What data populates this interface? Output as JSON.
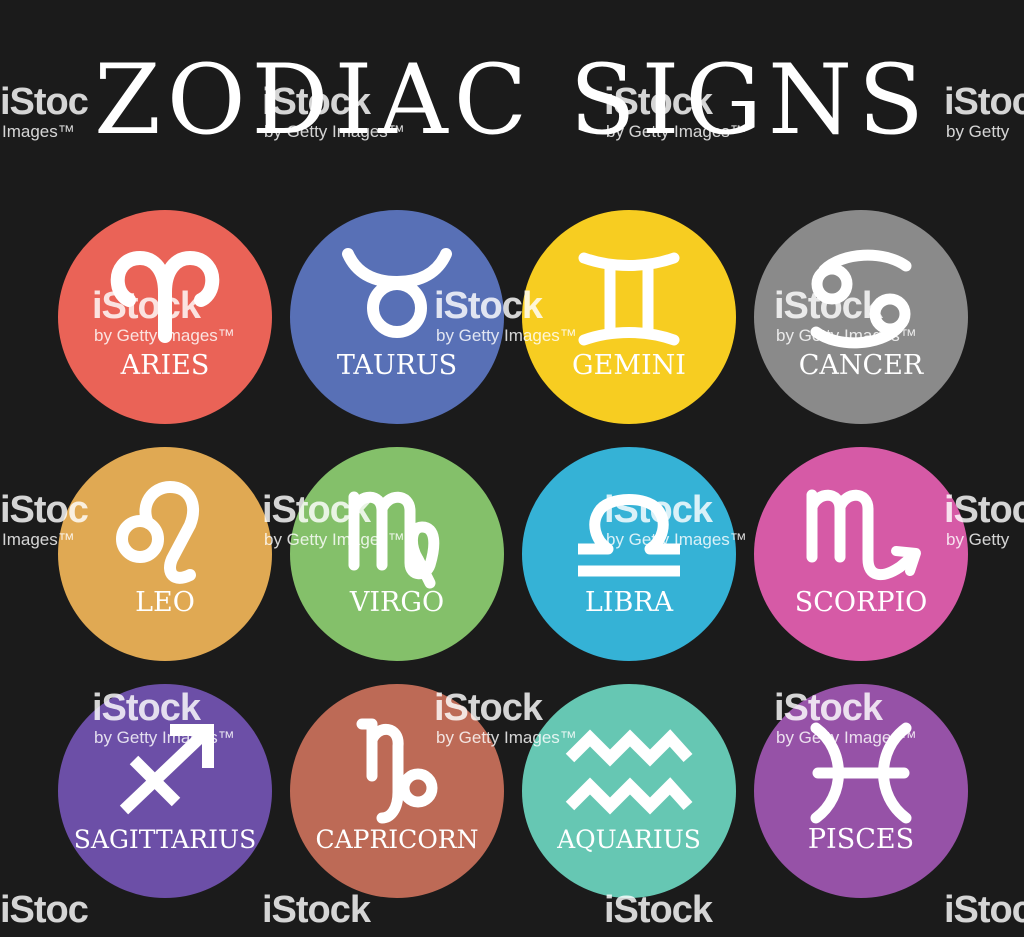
{
  "title": "ZODIAC SIGNS",
  "colors": {
    "background": "#1b1b1b",
    "aries": "#ea6357",
    "taurus": "#5870b6",
    "gemini": "#f7cd21",
    "cancer": "#8a8a8a",
    "leo": "#e0a953",
    "virgo": "#84c06a",
    "libra": "#35b2d6",
    "scorpio": "#d65aa6",
    "sagittarius": "#6c4fa7",
    "capricorn": "#bd6a56",
    "aquarius": "#66c7b3",
    "pisces": "#9652a7",
    "symbol": "#ffffff"
  },
  "signs": [
    {
      "label": "ARIES",
      "icon": "aries-icon"
    },
    {
      "label": "TAURUS",
      "icon": "taurus-icon"
    },
    {
      "label": "GEMINI",
      "icon": "gemini-icon"
    },
    {
      "label": "CANCER",
      "icon": "cancer-icon"
    },
    {
      "label": "LEO",
      "icon": "leo-icon"
    },
    {
      "label": "VIRGO",
      "icon": "virgo-icon"
    },
    {
      "label": "LIBRA",
      "icon": "libra-icon"
    },
    {
      "label": "SCORPIO",
      "icon": "scorpio-icon"
    },
    {
      "label": "SAGITTARIUS",
      "icon": "sagittarius-icon"
    },
    {
      "label": "CAPRICORN",
      "icon": "capricorn-icon"
    },
    {
      "label": "AQUARIUS",
      "icon": "aquarius-icon"
    },
    {
      "label": "PISCES",
      "icon": "pisces-icon"
    }
  ],
  "watermark": {
    "brand": "iStock",
    "credit": "by Getty Images™",
    "brand_cut": "iStoc",
    "credit_cut": "by Getty",
    "credit_left": "Images™"
  }
}
